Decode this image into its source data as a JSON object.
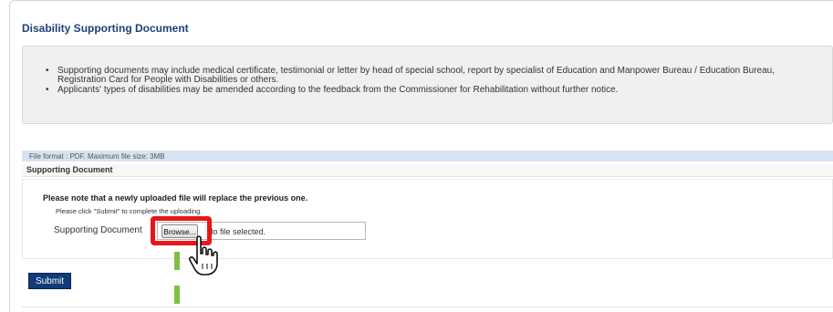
{
  "section": {
    "title": "Disability Supporting Document"
  },
  "notes": [
    "Supporting documents may include medical certificate, testimonial or letter by head of special school, report by specialist of Education and Manpower Bureau / Education Bureau, Registration Card for People with Disabilities or others.",
    "Applicants' types of disabilities may be amended according to the feedback from the Commissioner for Rehabilitation without further notice."
  ],
  "upload": {
    "format_hint": "File format : PDF. Maximum file size: 3MB",
    "section_label": "Supporting Document",
    "replace_warning": "Please note that a newly uploaded file will replace the previous one.",
    "submit_note": "Please click \"Submit\" to complete the uploading.",
    "field_label": "Supporting Document",
    "browse_label": "Browse...",
    "file_status": "No file selected."
  },
  "actions": {
    "submit_label": "Submit"
  },
  "colors": {
    "title": "#1d3f7a",
    "submit_bg": "#123b78",
    "highlight": "#e8161a",
    "guide": "#7cc242",
    "hint_bar": "#d6e3f1"
  },
  "icons": {
    "pointer": "hand-pointer-icon"
  }
}
